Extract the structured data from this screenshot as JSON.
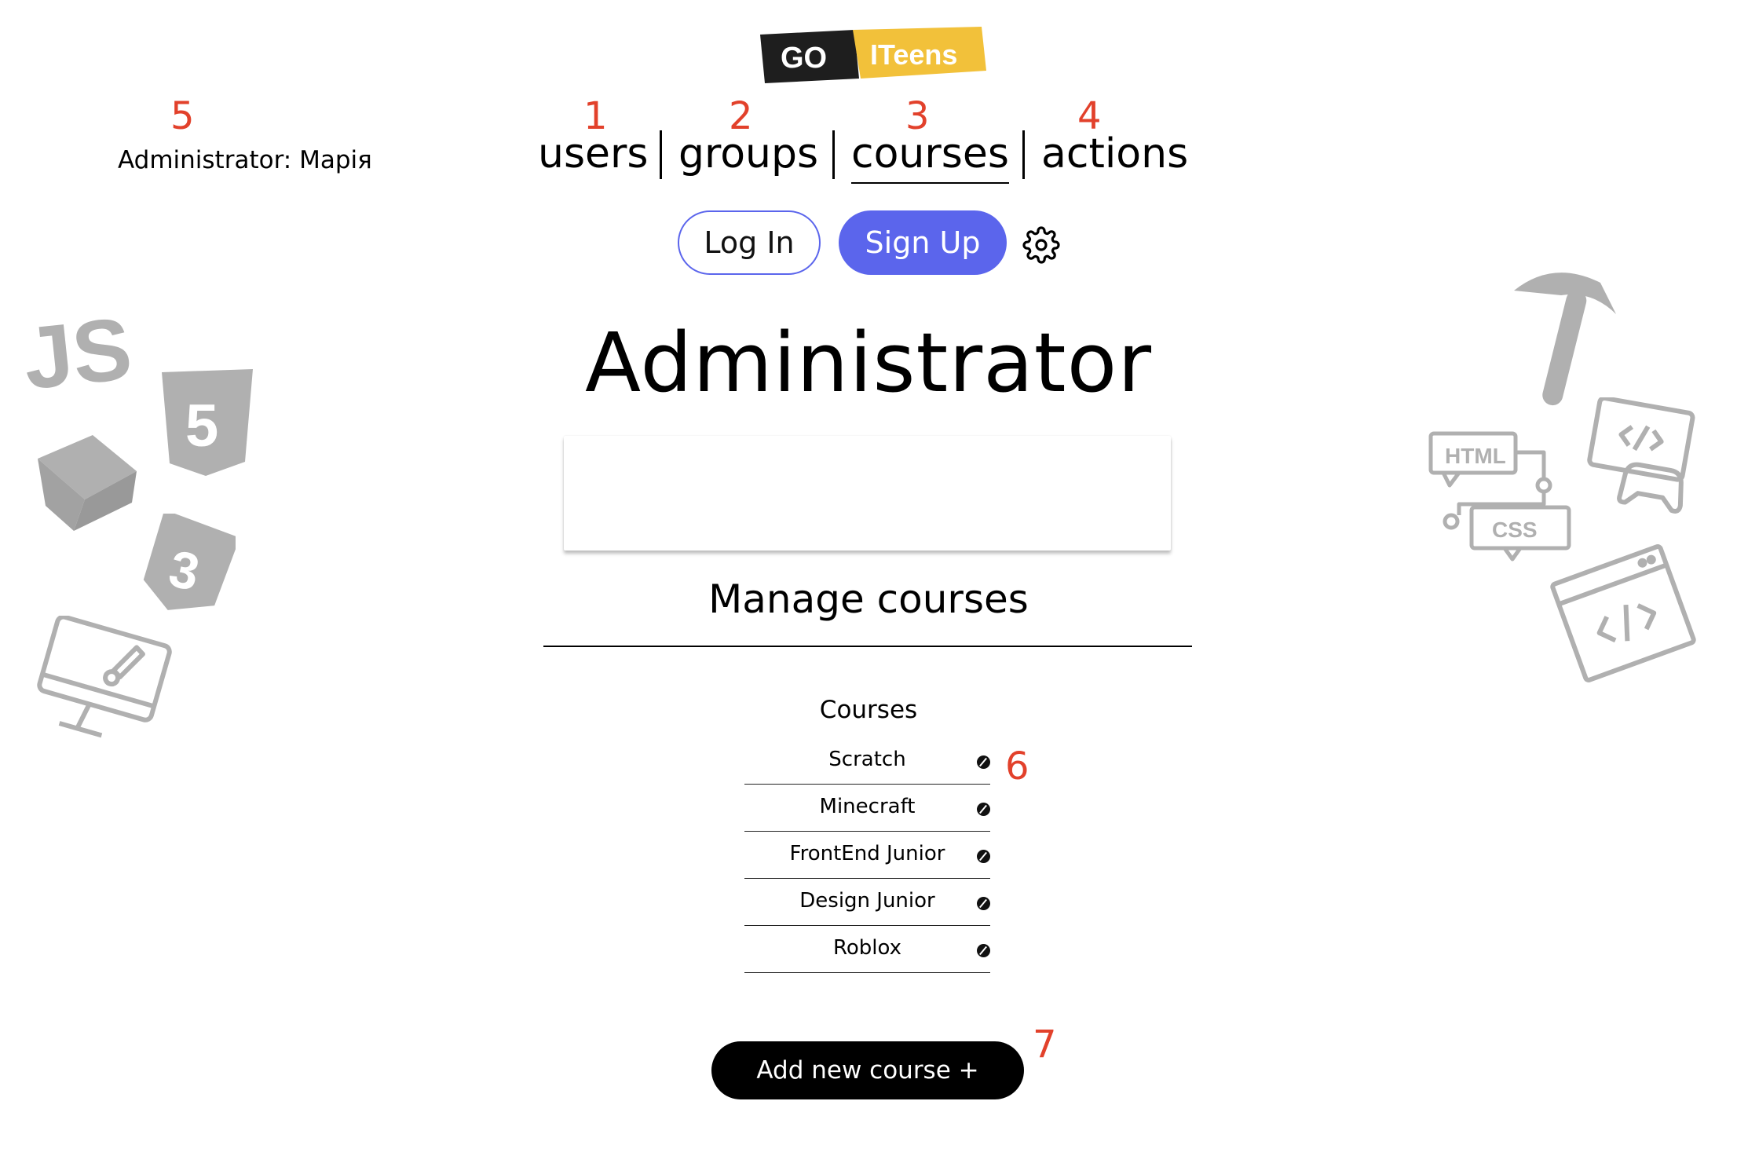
{
  "logo": {
    "part1": "GO",
    "part2": "ITeens"
  },
  "markers": {
    "users": "1",
    "groups": "2",
    "courses": "3",
    "actions": "4",
    "admin": "5",
    "edit": "6",
    "add": "7"
  },
  "admin_label": "Administrator: Марія",
  "nav": {
    "users": "users",
    "groups": "groups",
    "courses": "courses",
    "actions": "actions"
  },
  "auth": {
    "login": "Log In",
    "signup": "Sign Up"
  },
  "page_title": "Administrator",
  "section_title": "Manage courses",
  "courses": {
    "header": "Courses",
    "items": [
      "Scratch",
      "Minecraft",
      "FrontEnd Junior",
      "Design Junior",
      "Roblox"
    ]
  },
  "add_button": "Add new course +",
  "deco_labels": {
    "js": "JS",
    "html": "HTML",
    "css": "CSS"
  },
  "colors": {
    "accent": "#5b65ec",
    "marker": "#e2412b",
    "logo_yellow": "#f2c13a",
    "deco_grey": "#b0b0b0"
  }
}
